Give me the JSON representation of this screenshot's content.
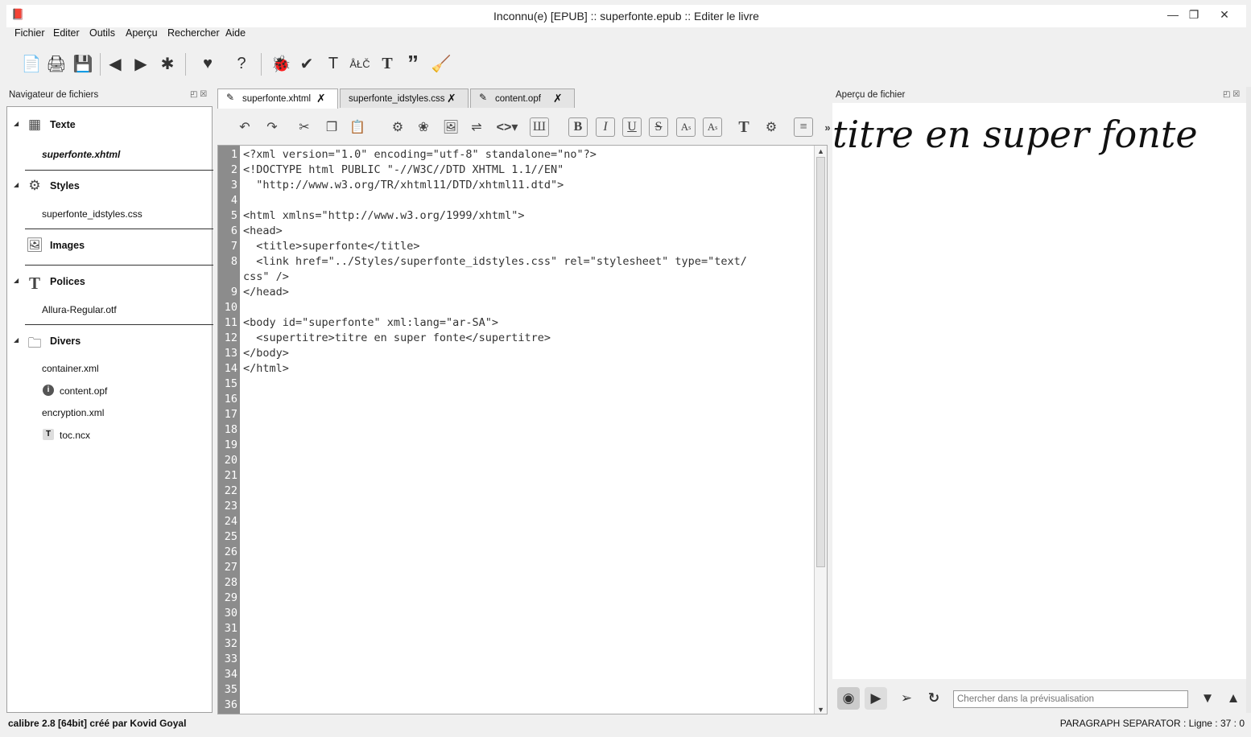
{
  "window": {
    "title": "Inconnu(e) [EPUB] :: superfonte.epub :: Editer le livre",
    "minimize": "—",
    "restore": "❐",
    "close": "✕"
  },
  "menu": [
    "Fichier",
    "Editer",
    "Outils",
    "Aperçu",
    "Rechercher",
    "Aide"
  ],
  "toolbar": {
    "icons": [
      "new-file-icon",
      "import-icon",
      "save-icon",
      "back-icon",
      "forward-icon",
      "checkpoint-icon",
      "donate-heart-icon",
      "help-icon",
      "check-book-icon",
      "spellcheck-icon",
      "text-icon",
      "character-icon",
      "font-icon",
      "quote-icon",
      "broom-icon"
    ]
  },
  "navigator": {
    "title": "Navigateur de fichiers",
    "categories": [
      {
        "label": "Texte",
        "files": [
          "superfonte.xhtml"
        ]
      },
      {
        "label": "Styles",
        "files": [
          "superfonte_idstyles.css"
        ]
      },
      {
        "label": "Images",
        "files": []
      },
      {
        "label": "Polices",
        "files": [
          "Allura-Regular.otf"
        ]
      },
      {
        "label": "Divers",
        "files": [
          "container.xml",
          "content.opf",
          "encryption.xml",
          "toc.ncx"
        ]
      }
    ]
  },
  "editor": {
    "tabs": [
      {
        "label": "superfonte.xhtml",
        "close": "✗"
      },
      {
        "label": "superfonte_idstyles.css",
        "close": "✗"
      },
      {
        "label": "content.opf",
        "close": "✗"
      }
    ],
    "more": "»",
    "line_numbers": [
      "1",
      "2",
      "3",
      "4",
      "5",
      "6",
      "7",
      "8",
      "",
      "9",
      "10",
      "11",
      "12",
      "13",
      "14",
      "15",
      "16",
      "17",
      "18",
      "19",
      "20",
      "21",
      "22",
      "23",
      "24",
      "25",
      "26",
      "27",
      "28",
      "29",
      "30",
      "31",
      "32",
      "33",
      "34",
      "35",
      "36"
    ],
    "code_lines": [
      "<?xml version=\"1.0\" encoding=\"utf-8\" standalone=\"no\"?>",
      "<!DOCTYPE html PUBLIC \"-//W3C//DTD XHTML 1.1//EN\"",
      "  \"http://www.w3.org/TR/xhtml11/DTD/xhtml11.dtd\">",
      "",
      "<html xmlns=\"http://www.w3.org/1999/xhtml\">",
      "<head>",
      "  <title>superfonte</title>",
      "  <link href=\"../Styles/superfonte_idstyles.css\" rel=\"stylesheet\" type=\"text/",
      "css\" />",
      "</head>",
      "",
      "<body id=\"superfonte\" xml:lang=\"ar-SA\">",
      "  <supertitre>titre en super fonte</supertitre>",
      "</body>",
      "</html>"
    ]
  },
  "preview": {
    "title": "Aperçu de fichier",
    "rendered_text": "titre en super fonte",
    "search_placeholder": "Chercher dans la prévisualisation"
  },
  "status": {
    "left": "calibre 2.8 [64bit] créé par Kovid Goyal",
    "right": "PARAGRAPH SEPARATOR : Ligne : 37 : 0"
  }
}
